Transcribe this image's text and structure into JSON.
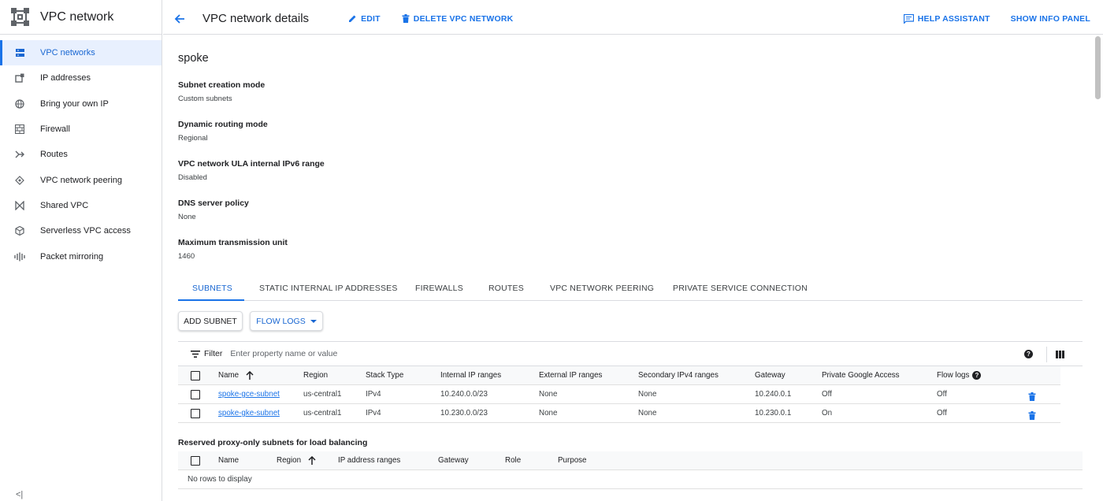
{
  "sidebar": {
    "title": "VPC network",
    "items": [
      {
        "label": "VPC networks",
        "icon": "vpc-networks-icon",
        "active": true
      },
      {
        "label": "IP addresses",
        "icon": "ip-addresses-icon",
        "active": false
      },
      {
        "label": "Bring your own IP",
        "icon": "globe-icon",
        "active": false
      },
      {
        "label": "Firewall",
        "icon": "firewall-icon",
        "active": false
      },
      {
        "label": "Routes",
        "icon": "routes-icon",
        "active": false
      },
      {
        "label": "VPC network peering",
        "icon": "peering-icon",
        "active": false
      },
      {
        "label": "Shared VPC",
        "icon": "shared-vpc-icon",
        "active": false
      },
      {
        "label": "Serverless VPC access",
        "icon": "serverless-icon",
        "active": false
      },
      {
        "label": "Packet mirroring",
        "icon": "packet-mirroring-icon",
        "active": false
      }
    ],
    "collapse_glyph": "<|"
  },
  "header": {
    "title": "VPC network details",
    "edit_label": "EDIT",
    "delete_label": "DELETE VPC NETWORK",
    "help_label": "HELP ASSISTANT",
    "info_label": "SHOW INFO PANEL"
  },
  "network": {
    "name": "spoke",
    "properties": [
      {
        "label": "Subnet creation mode",
        "value": "Custom subnets"
      },
      {
        "label": "Dynamic routing mode",
        "value": "Regional"
      },
      {
        "label": "VPC network ULA internal IPv6 range",
        "value": "Disabled"
      },
      {
        "label": "DNS server policy",
        "value": "None"
      },
      {
        "label": "Maximum transmission unit",
        "value": "1460"
      }
    ]
  },
  "tabs": [
    {
      "label": "SUBNETS",
      "active": true
    },
    {
      "label": "STATIC INTERNAL IP ADDRESSES",
      "active": false
    },
    {
      "label": "FIREWALLS",
      "active": false
    },
    {
      "label": "ROUTES",
      "active": false
    },
    {
      "label": "VPC NETWORK PEERING",
      "active": false
    },
    {
      "label": "PRIVATE SERVICE CONNECTION",
      "active": false
    }
  ],
  "actions": {
    "add_subnet": "ADD SUBNET",
    "flow_logs": "FLOW LOGS"
  },
  "filter": {
    "label": "Filter",
    "placeholder": "Enter property name or value",
    "help_glyph": "?"
  },
  "subnets_table": {
    "columns": [
      "Name",
      "Region",
      "Stack Type",
      "Internal IP ranges",
      "External IP ranges",
      "Secondary IPv4 ranges",
      "Gateway",
      "Private Google Access",
      "Flow logs"
    ],
    "flow_logs_help": "?",
    "rows": [
      {
        "name": "spoke-gce-subnet",
        "region": "us-central1",
        "stack": "IPv4",
        "internal": "10.240.0.0/23",
        "external": "None",
        "secondary": "None",
        "gateway": "10.240.0.1",
        "pga": "Off",
        "flow_logs": "Off"
      },
      {
        "name": "spoke-gke-subnet",
        "region": "us-central1",
        "stack": "IPv4",
        "internal": "10.230.0.0/23",
        "external": "None",
        "secondary": "None",
        "gateway": "10.230.0.1",
        "pga": "On",
        "flow_logs": "Off"
      }
    ]
  },
  "proxy_section": {
    "title": "Reserved proxy-only subnets for load balancing",
    "columns": [
      "Name",
      "Region",
      "IP address ranges",
      "Gateway",
      "Role",
      "Purpose"
    ],
    "empty_text": "No rows to display"
  },
  "colors": {
    "accent": "#1a73e8",
    "active_bg": "#e8f0fe",
    "border": "#dadce0"
  }
}
